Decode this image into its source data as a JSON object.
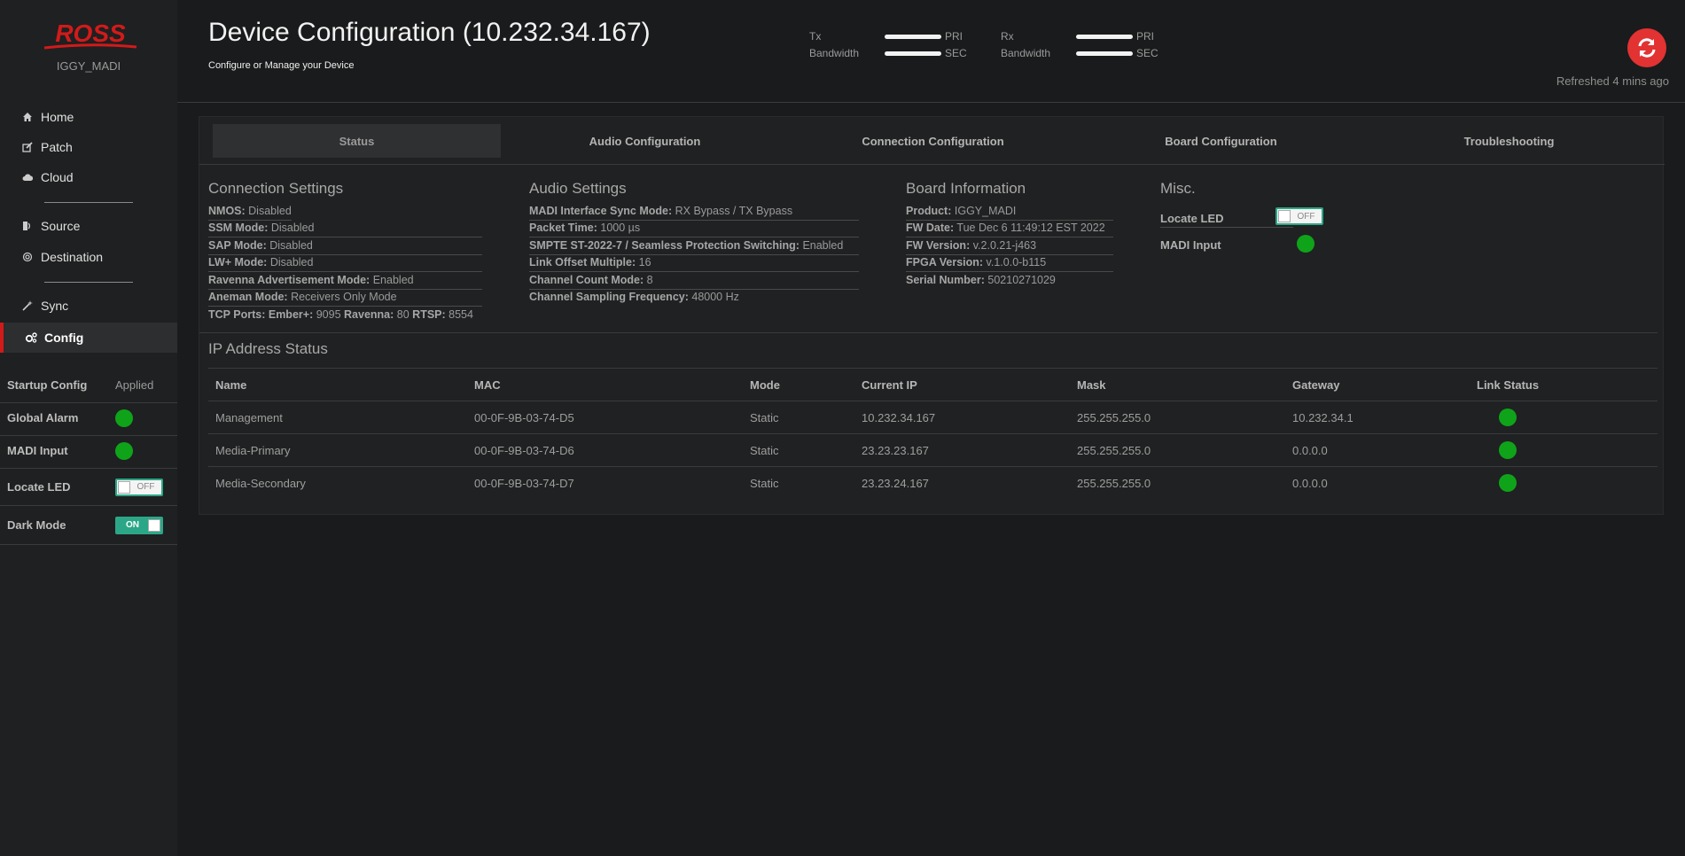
{
  "colors": {
    "accent": "#d21a1a",
    "ok": "#0fa31a",
    "toggle": "#2ba787",
    "background": "#1a1b1c"
  },
  "sidebar": {
    "logo": "ROSS",
    "device_name": "IGGY_MADI",
    "nav": [
      {
        "label": "Home",
        "icon": "home-icon"
      },
      {
        "label": "Patch",
        "icon": "edit-icon"
      },
      {
        "label": "Cloud",
        "icon": "cloud-icon"
      },
      {
        "label": "Source",
        "icon": "source-icon"
      },
      {
        "label": "Destination",
        "icon": "destination-icon"
      },
      {
        "label": "Sync",
        "icon": "wand-icon"
      },
      {
        "label": "Config",
        "icon": "gears-icon"
      }
    ],
    "status": {
      "startup_config_label": "Startup Config",
      "startup_config_value": "Applied",
      "global_alarm_label": "Global Alarm",
      "madi_input_label": "MADI Input",
      "locate_led_label": "Locate LED",
      "locate_led_value": "OFF",
      "dark_mode_label": "Dark Mode",
      "dark_mode_value": "ON"
    }
  },
  "header": {
    "title": "Device Configuration (10.232.34.167)",
    "subtitle": "Configure or Manage your Device",
    "tx_label_1": "Tx",
    "tx_label_2": "Bandwidth",
    "rx_label_1": "Rx",
    "rx_label_2": "Bandwidth",
    "pri": "PRI",
    "sec": "SEC",
    "refreshed": "Refreshed 4 mins ago"
  },
  "tabs": [
    "Status",
    "Audio Configuration",
    "Connection Configuration",
    "Board Configuration",
    "Troubleshooting"
  ],
  "connection_settings": {
    "title": "Connection Settings",
    "nmos_k": "NMOS:",
    "nmos_v": "Disabled",
    "ssm_k": "SSM Mode:",
    "ssm_v": "Disabled",
    "sap_k": "SAP Mode:",
    "sap_v": "Disabled",
    "lw_k": "LW+ Mode:",
    "lw_v": "Disabled",
    "rav_k": "Ravenna Advertisement Mode:",
    "rav_v": "Enabled",
    "aneman_k": "Aneman Mode:",
    "aneman_v": "Receivers Only Mode",
    "tcp_k": "TCP Ports:",
    "ember_k": "Ember+:",
    "ember_v": "9095",
    "ravp_k": "Ravenna:",
    "ravp_v": "80",
    "rtsp_k": "RTSP:",
    "rtsp_v": "8554"
  },
  "audio_settings": {
    "title": "Audio Settings",
    "sync_k": "MADI Interface Sync Mode:",
    "sync_v": "RX Bypass / TX Bypass",
    "pkt_k": "Packet Time:",
    "pkt_v": "1000 µs",
    "smpte_k": "SMPTE ST-2022-7 / Seamless Protection Switching:",
    "smpte_v": "Enabled",
    "lom_k": "Link Offset Multiple:",
    "lom_v": "16",
    "ccm_k": "Channel Count Mode:",
    "ccm_v": "8",
    "csf_k": "Channel Sampling Frequency:",
    "csf_v": "48000 Hz"
  },
  "board_info": {
    "title": "Board Information",
    "product_k": "Product:",
    "product_v": "IGGY_MADI",
    "fwdate_k": "FW Date:",
    "fwdate_v": "Tue Dec 6 11:49:12 EST 2022",
    "fwver_k": "FW Version:",
    "fwver_v": "v.2.0.21-j463",
    "fpga_k": "FPGA Version:",
    "fpga_v": "v.1.0.0-b115",
    "serial_k": "Serial Number:",
    "serial_v": "50210271029"
  },
  "misc": {
    "title": "Misc.",
    "locate_led": "Locate LED",
    "locate_led_value": "OFF",
    "madi_input": "MADI Input"
  },
  "ip_status": {
    "title": "IP Address Status",
    "columns": [
      "Name",
      "MAC",
      "Mode",
      "Current IP",
      "Mask",
      "Gateway",
      "Link Status"
    ],
    "rows": [
      {
        "name": "Management",
        "mac": "00-0F-9B-03-74-D5",
        "mode": "Static",
        "ip": "10.232.34.167",
        "mask": "255.255.255.0",
        "gateway": "10.232.34.1",
        "link": "up"
      },
      {
        "name": "Media-Primary",
        "mac": "00-0F-9B-03-74-D6",
        "mode": "Static",
        "ip": "23.23.23.167",
        "mask": "255.255.255.0",
        "gateway": "0.0.0.0",
        "link": "up"
      },
      {
        "name": "Media-Secondary",
        "mac": "00-0F-9B-03-74-D7",
        "mode": "Static",
        "ip": "23.23.24.167",
        "mask": "255.255.255.0",
        "gateway": "0.0.0.0",
        "link": "up"
      }
    ]
  }
}
